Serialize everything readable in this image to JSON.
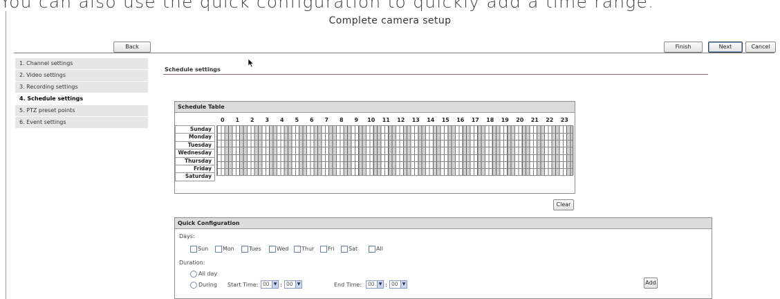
{
  "caption": "You can also use the quick configuration to quickly add a time range.",
  "page_title": "Complete camera setup",
  "buttons": {
    "back": "Back",
    "finish": "Finish",
    "next": "Next",
    "cancel": "Cancel",
    "clear": "Clear",
    "add": "Add"
  },
  "sidebar": {
    "items": [
      {
        "label": "1. Channel settings",
        "active": false
      },
      {
        "label": "2. Video settings",
        "active": false
      },
      {
        "label": "3. Recording settings",
        "active": false
      },
      {
        "label": "4. Schedule settings",
        "active": true
      },
      {
        "label": "5. PTZ preset points",
        "active": false
      },
      {
        "label": "6. Event settings",
        "active": false
      }
    ]
  },
  "section_title": "Schedule settings",
  "schedule": {
    "header": "Schedule Table",
    "hours": [
      "0",
      "1",
      "2",
      "3",
      "4",
      "5",
      "6",
      "7",
      "8",
      "9",
      "10",
      "11",
      "12",
      "13",
      "14",
      "15",
      "16",
      "17",
      "18",
      "19",
      "20",
      "21",
      "22",
      "23"
    ],
    "days": [
      "Sunday",
      "Monday",
      "Tuesday",
      "Wednesday",
      "Thursday",
      "Friday",
      "Saturday"
    ]
  },
  "quick": {
    "header": "Quick Configuration",
    "days_label": "Days:",
    "days": [
      "Sun",
      "Mon",
      "Tues",
      "Wed",
      "Thur",
      "Fri",
      "Sat",
      "All"
    ],
    "duration_label": "Duration:",
    "all_day": "All day",
    "during": "During",
    "start_label": "Start Time:",
    "end_label": "End Time:",
    "start_hour": "00",
    "start_min": "00",
    "end_hour": "00",
    "end_min": "00",
    "colon": ":"
  }
}
